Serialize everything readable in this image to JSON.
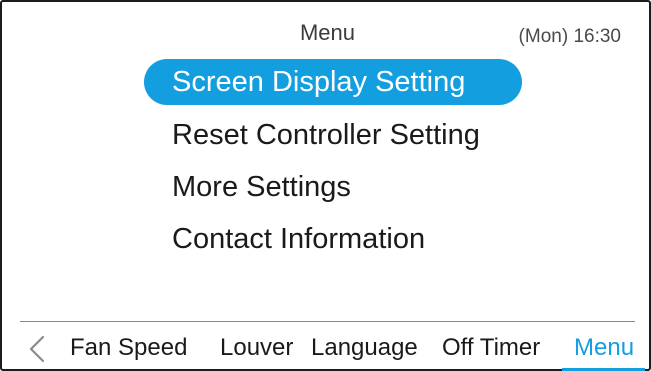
{
  "header": {
    "title": "Menu",
    "clock": "(Mon) 16:30"
  },
  "menu": {
    "items": [
      {
        "label": "Screen Display Setting",
        "selected": true
      },
      {
        "label": "Reset Controller Setting",
        "selected": false
      },
      {
        "label": "More Settings",
        "selected": false
      },
      {
        "label": "Contact Information",
        "selected": false
      }
    ]
  },
  "tabbar": {
    "back_icon": "chevron-left-icon",
    "tabs": [
      {
        "label": "Fan Speed",
        "active": false
      },
      {
        "label": "Louver",
        "active": false
      },
      {
        "label": "Language",
        "active": false
      },
      {
        "label": "Off Timer",
        "active": false
      },
      {
        "label": "Menu",
        "active": true
      }
    ]
  },
  "colors": {
    "accent": "#139ee0",
    "text": "#1a1a1a",
    "frame": "#1c1c1c",
    "divider": "#8a8a8a"
  }
}
